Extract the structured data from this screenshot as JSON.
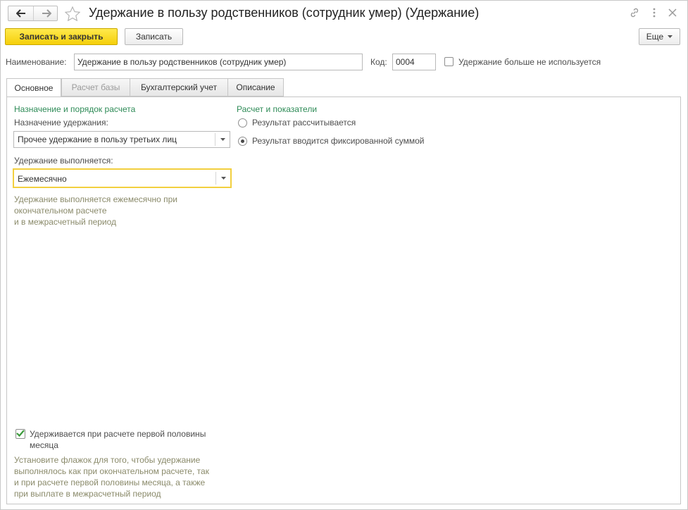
{
  "window": {
    "title": "Удержание в пользу родственников (сотрудник умер) (Удержание)"
  },
  "icons": {
    "back": "arrow-left-icon",
    "forward": "arrow-right-icon",
    "favorite": "star-icon",
    "link": "link-icon",
    "menu": "more-vertical-icon",
    "close": "close-icon"
  },
  "toolbar": {
    "save_close_label": "Записать и закрыть",
    "save_label": "Записать",
    "more_label": "Еще"
  },
  "header": {
    "name_label": "Наименование:",
    "name_value": "Удержание в пользу родственников (сотрудник умер)",
    "code_label": "Код:",
    "code_value": "0004",
    "unused_label": "Удержание больше не используется"
  },
  "tabs": [
    {
      "label": "Основное",
      "state": "active"
    },
    {
      "label": "Расчет базы",
      "state": "disabled"
    },
    {
      "label": "Бухгалтерский учет",
      "state": "normal"
    },
    {
      "label": "Описание",
      "state": "normal"
    }
  ],
  "main": {
    "left": {
      "group_title": "Назначение и порядок расчета",
      "purpose_label": "Назначение удержания:",
      "purpose_value": "Прочее удержание в пользу третьих лиц",
      "performed_label": "Удержание выполняется:",
      "performed_value": "Ежемесячно",
      "performed_hint_1": "Удержание выполняется ежемесячно при",
      "performed_hint_2": "окончательном расчете",
      "performed_hint_3": "и в межрасчетный период"
    },
    "right": {
      "group_title": "Расчет и показатели",
      "radio_calc_label": "Результат рассчитывается",
      "radio_fixed_label": "Результат вводится фиксированной суммой",
      "selected": "fixed"
    },
    "bottom": {
      "checkbox_label_1": "Удерживается при расчете первой половины",
      "checkbox_label_2": "месяца",
      "checkbox_checked": true,
      "hint_1": "Установите флажок для того, чтобы удержание",
      "hint_2": "выполнялось как при окончательном расчете, так",
      "hint_3": "и при расчете первой половины месяца, а также",
      "hint_4": "при выплате в межрасчетный период"
    }
  },
  "colors": {
    "accent_yellow": "#f5cf0a",
    "group_title_green": "#2e8b57",
    "focus_border": "#f2cf3f"
  }
}
